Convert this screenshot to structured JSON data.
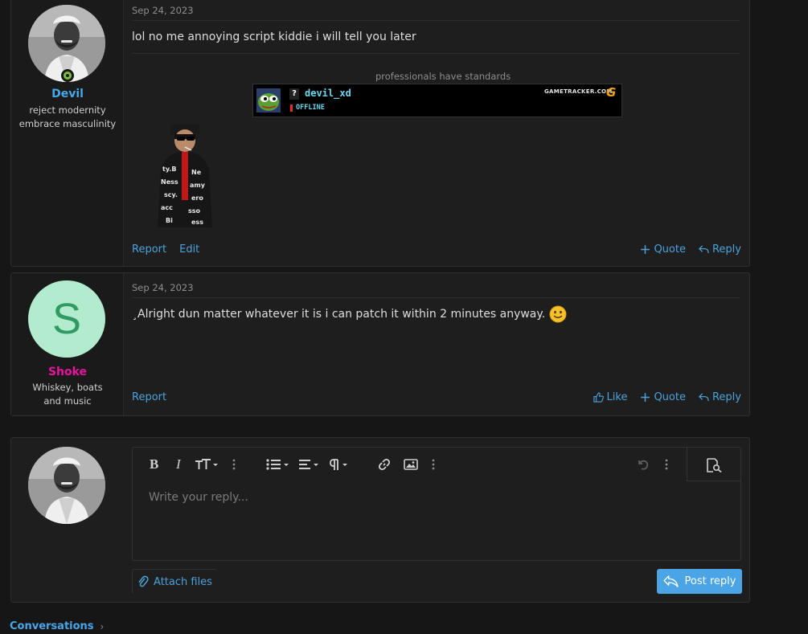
{
  "post1": {
    "date": "Sep 24, 2023",
    "body": "lol no me annoying script kiddie i will tell you later",
    "username": "Devil",
    "user_title_line1": "reject modernity",
    "user_title_line2": "embrace masculinity",
    "signature_caption": "professionals have standards",
    "banner": {
      "badge": "?",
      "player": "devil_xd",
      "status": "OFFLINE",
      "brand": "GAMETRACKER.COM"
    },
    "actions_left": [
      "Report",
      "Edit"
    ],
    "quote_label": "Quote",
    "reply_label": "Reply"
  },
  "post2": {
    "date": "Sep 24, 2023",
    "body": "¸Alright dun matter whatever it is i can patch it within 2 minutes anyway.",
    "avatar_letter": "S",
    "username": "Shoke",
    "user_title": "Whiskey, boats and music",
    "report_label": "Report",
    "like_label": "Like",
    "quote_label": "Quote",
    "reply_label": "Reply"
  },
  "reply_box": {
    "placeholder": "Write your reply...",
    "attach_label": "Attach files",
    "post_label": "Post reply"
  },
  "footer": {
    "link": "Conversations"
  },
  "colors": {
    "accent": "#4aa3dc",
    "devil_name": "#47a7eb",
    "shoke_name": "#e8149e",
    "shoke_avatar_bg": "#b3ebcf",
    "shoke_avatar_fg": "#2f9a61",
    "online": "#7fbf3f",
    "post_button": "#4ba4e6"
  }
}
